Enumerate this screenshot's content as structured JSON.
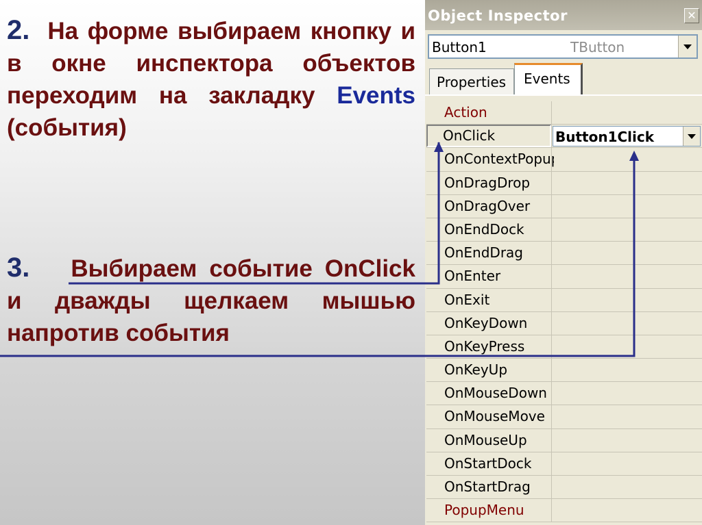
{
  "slide": {
    "step2": {
      "number": "2.",
      "text_before": "На форме выбираем кнопку и в окне инспектора объектов переходим на закладку",
      "events_word": "Events",
      "text_after": "(события)"
    },
    "step3": {
      "number": "3.",
      "text": "Выбираем событие OnClick и дважды щелкаем мышью напротив события"
    }
  },
  "inspector": {
    "title": "Object Inspector",
    "close_glyph": "✕",
    "object_name": "Button1",
    "object_type": "TButton",
    "tabs": [
      "Properties",
      "Events"
    ],
    "active_tab": "Events",
    "events": [
      {
        "name": "Action",
        "value": ""
      },
      {
        "name": "OnClick",
        "value": "Button1Click"
      },
      {
        "name": "OnContextPopup",
        "value": ""
      },
      {
        "name": "OnDragDrop",
        "value": ""
      },
      {
        "name": "OnDragOver",
        "value": ""
      },
      {
        "name": "OnEndDock",
        "value": ""
      },
      {
        "name": "OnEndDrag",
        "value": ""
      },
      {
        "name": "OnEnter",
        "value": ""
      },
      {
        "name": "OnExit",
        "value": ""
      },
      {
        "name": "OnKeyDown",
        "value": ""
      },
      {
        "name": "OnKeyPress",
        "value": ""
      },
      {
        "name": "OnKeyUp",
        "value": ""
      },
      {
        "name": "OnMouseDown",
        "value": ""
      },
      {
        "name": "OnMouseMove",
        "value": ""
      },
      {
        "name": "OnMouseUp",
        "value": ""
      },
      {
        "name": "OnStartDock",
        "value": ""
      },
      {
        "name": "OnStartDrag",
        "value": ""
      },
      {
        "name": "PopupMenu",
        "value": ""
      }
    ],
    "selected_event": "OnClick"
  },
  "colors": {
    "text": "#6a1010",
    "step_number": "#1f2d6b",
    "accent": "#1a2a9a",
    "arrow": "#2a2f8a",
    "link_property": "#800000"
  }
}
